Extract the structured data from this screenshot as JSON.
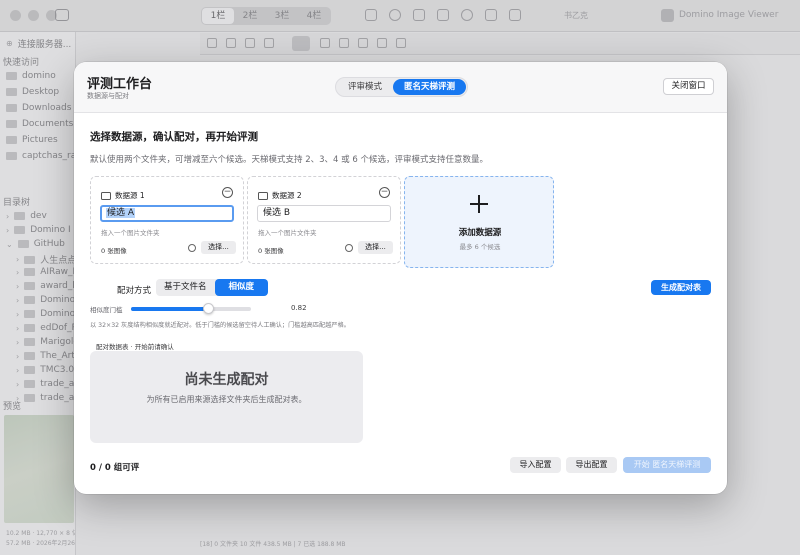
{
  "background_window": {
    "column_tabs": [
      "1栏",
      "2栏",
      "3栏",
      "4栏"
    ],
    "app_name": "Domino Image Viewer",
    "toolbar_text": "书乙克",
    "sidebar": {
      "connect": "连接服务器...",
      "quick_access": "快速访问",
      "favorites": [
        "domino",
        "Desktop",
        "Downloads",
        "Documents",
        "Pictures",
        "captchas_ra"
      ],
      "tree_header": "目录树",
      "tree": [
        "dev",
        "Domino I",
        "GitHub",
        "人生点点",
        "AIRaw_P",
        "award_b",
        "Domino",
        "Domino",
        "edDof_P",
        "Marigolc",
        "The_Art",
        "TMC3.0",
        "trade_ar",
        "trade_ar"
      ],
      "preview_header": "预览",
      "meta_line1": "10.2 MB · 12,770 × 8 亿 · JPEG · sRGB",
      "meta_line2": "57.2 MB · 2026年2月26日 12:19"
    },
    "statusbar": "[18]   0 文件夹   10 文件   438.5 MB   |   7 已选   188.8 MB"
  },
  "modal": {
    "title": "评测工作台",
    "subtitle": "数据源与配对",
    "modes": [
      {
        "label": "评审模式",
        "active": false
      },
      {
        "label": "匿名天梯评测",
        "active": true
      }
    ],
    "close_label": "关闭窗口",
    "heading": "选择数据源，确认配对，再开始评测",
    "description": "默认使用两个文件夹，可增减至六个候选。天梯模式支持 2、3、4 或 6 个候选，评审模式支持任意数量。",
    "sources": [
      {
        "title": "数据源 1",
        "value": "候选 A",
        "hint": "拖入一个图片文件夹",
        "count": "0 张图像",
        "choose": "选择..."
      },
      {
        "title": "数据源 2",
        "value": "候选 B",
        "hint": "拖入一个图片文件夹",
        "count": "0 张图像",
        "choose": "选择..."
      }
    ],
    "add_source": {
      "title": "添加数据源",
      "subtitle": "最多 6 个候选"
    },
    "pairing": {
      "label": "配对方式",
      "options": [
        {
          "label": "基于文件名",
          "active": false
        },
        {
          "label": "相似度",
          "active": true
        }
      ],
      "generate_label": "生成配对表"
    },
    "threshold": {
      "label": "相似度门槛",
      "value": 0.82,
      "value_text": "0.82",
      "description": "以 32×32 灰度结构相似度就近配对。低于门槛的候选留空待人工确认；门槛越高匹配越严格。"
    },
    "pair_table": {
      "label": "配对数据表 · 开始前请确认",
      "empty_title": "尚未生成配对",
      "empty_subtitle": "为所有已启用来源选择文件夹后生成配对表。"
    },
    "footer": {
      "count": "0 / 0 组可评",
      "import_label": "导入配置",
      "export_label": "导出配置",
      "start_label": "开始 匿名天梯评测"
    },
    "accent_color": "#1878f0"
  }
}
